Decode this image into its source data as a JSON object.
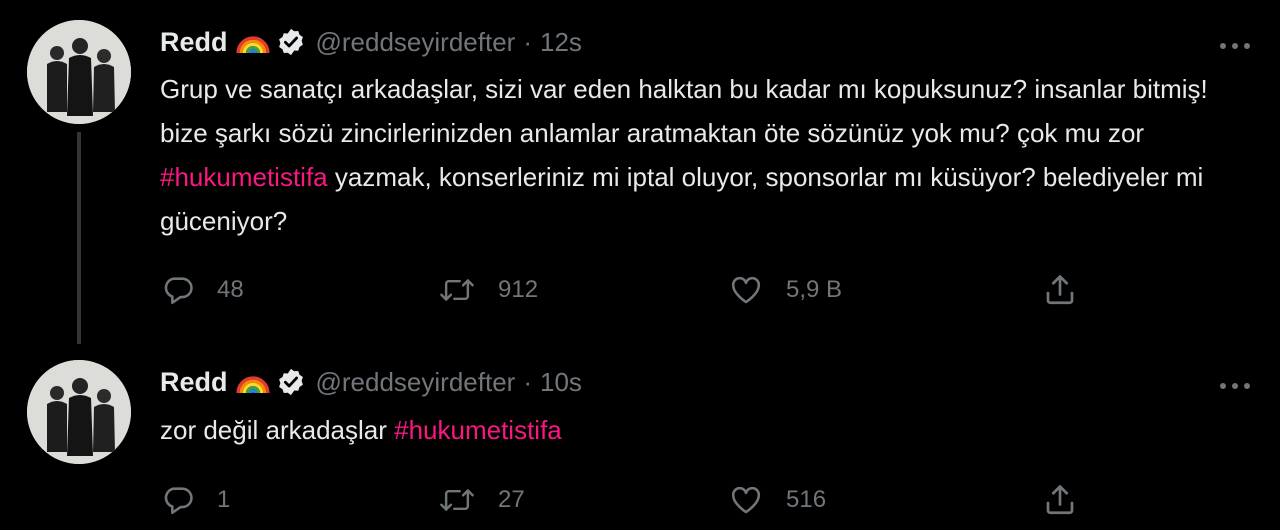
{
  "tweets": [
    {
      "name": "Redd",
      "handle": "@reddseyirdefter",
      "separator": "·",
      "time": "12s",
      "text_parts": [
        "Grup ve sanatçı arkadaşlar, sizi var eden halktan bu kadar mı kopuksunuz? insanlar bitmiş! bize şarkı sözü zincirlerinizden anlamlar aratmaktan öte sözünüz yok mu? çok mu zor ",
        "#hukumetistifa",
        " yazmak, konserleriniz mi iptal oluyor, sponsorlar mı küsüyor? belediyeler mi güceniyor?"
      ],
      "replies": "48",
      "retweets": "912",
      "likes": "5,9 B"
    },
    {
      "name": "Redd",
      "handle": "@reddseyirdefter",
      "separator": "·",
      "time": "10s",
      "text_parts": [
        "zor değil arkadaşlar ",
        "#hukumetistifa"
      ],
      "replies": "1",
      "retweets": "27",
      "likes": "516"
    }
  ],
  "icons": {
    "reply": "speech-bubble-icon",
    "retweet": "retweet-arrows-icon",
    "like": "heart-icon",
    "share": "upload-share-icon",
    "more": "three-dots-icon",
    "verified": "verified-badge-icon",
    "rainbow": "rainbow-emoji"
  },
  "colors": {
    "background": "#000000",
    "text": "#e7e9ea",
    "secondary_text": "#71767b",
    "hashtag": "#f91880",
    "thread_line": "#333639"
  }
}
